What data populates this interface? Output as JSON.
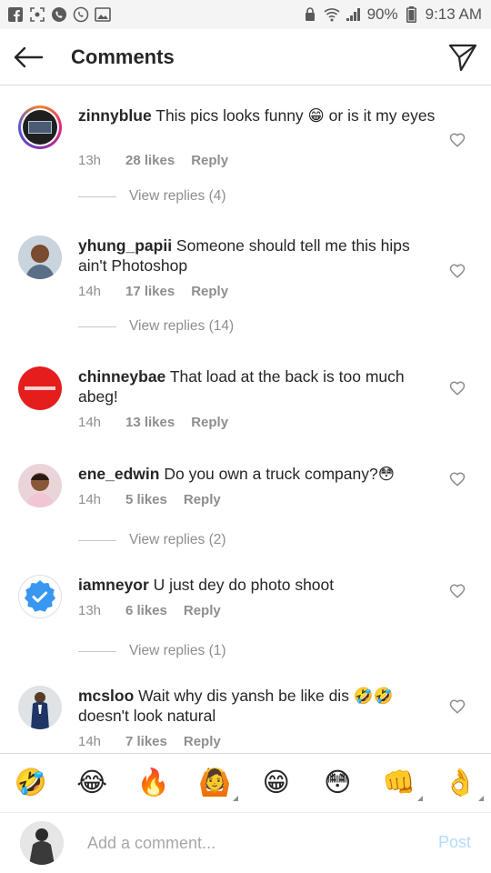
{
  "status_bar": {
    "battery": "90%",
    "time": "9:13 AM"
  },
  "header": {
    "title": "Comments"
  },
  "comments": [
    {
      "username": "zinnyblue",
      "text": " This pics looks funny 😁 or is it my eyes",
      "time": "13h",
      "likes": "28 likes",
      "reply": "Reply",
      "view_replies": "View replies (4)"
    },
    {
      "username": "yhung_papii",
      "text": " Someone should tell me this hips ain't Photoshop",
      "time": "14h",
      "likes": "17 likes",
      "reply": "Reply",
      "view_replies": "View replies (14)"
    },
    {
      "username": "chinneybae",
      "text": " That load at the back is too much abeg!",
      "time": "14h",
      "likes": "13 likes",
      "reply": "Reply",
      "view_replies": ""
    },
    {
      "username": "ene_edwin",
      "text": " Do you own a truck company?😳",
      "time": "14h",
      "likes": "5 likes",
      "reply": "Reply",
      "view_replies": "View replies (2)"
    },
    {
      "username": "iamneyor",
      "text": " U just dey do photo shoot",
      "time": "13h",
      "likes": "6 likes",
      "reply": "Reply",
      "view_replies": "View replies (1)"
    },
    {
      "username": "mcsloo",
      "text": " Wait why dis yansh be like dis 🤣🤣 doesn't look natural",
      "time": "14h",
      "likes": "7 likes",
      "reply": "Reply",
      "view_replies": ""
    }
  ],
  "emoji_bar": [
    "🤣",
    "😂",
    "🔥",
    "🙆",
    "😁",
    "😳",
    "👊",
    "👌"
  ],
  "compose": {
    "placeholder": "Add a comment...",
    "post_label": "Post"
  },
  "colors": {
    "accent_disabled": "#b3dbff",
    "muted_text": "#8e8e8e",
    "chinneybae_avatar": "#e51d1d",
    "verified_blue": "#3897f0"
  }
}
